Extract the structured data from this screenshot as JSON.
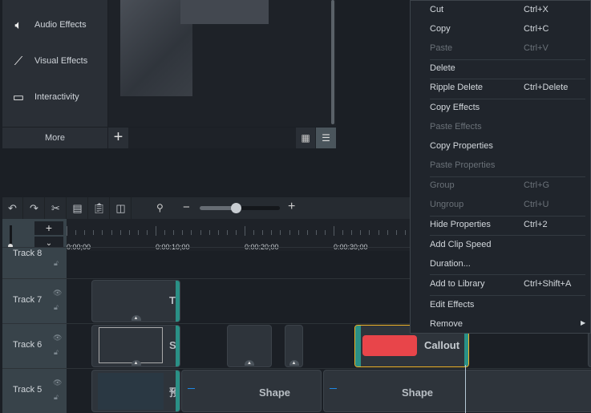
{
  "sidebar": {
    "items": [
      {
        "label": "Audio Effects",
        "icon": "speaker-icon"
      },
      {
        "label": "Visual Effects",
        "icon": "magic-wand-icon"
      },
      {
        "label": "Interactivity",
        "icon": "interactivity-icon"
      }
    ],
    "more_label": "More"
  },
  "media": {
    "add_label": "+",
    "view_grid_icon": "grid-icon",
    "view_list_icon": "list-icon"
  },
  "toolbar": {
    "zoom_minus": "−",
    "zoom_plus": "+",
    "zoom_level": 0.45
  },
  "ruler": {
    "labels": [
      "0:00;00",
      "0:00:10;00",
      "0:00:20;00",
      "0:00:30;00"
    ]
  },
  "tracks": [
    {
      "name": "Track 8"
    },
    {
      "name": "Track 7"
    },
    {
      "name": "Track 6"
    },
    {
      "name": "Track 5"
    }
  ],
  "clips": {
    "t7_label": "T",
    "t6_label": "S",
    "callout_label": "Callout",
    "t5_label": "预",
    "shape1": "Shape",
    "shape2": "Shape"
  },
  "colors": {
    "accent_teal": "#2a9086",
    "selection": "#f0b429",
    "callout_red": "#e8454a"
  },
  "context_menu": {
    "items": [
      {
        "label": "Cut",
        "shortcut": "Ctrl+X",
        "enabled": true
      },
      {
        "label": "Copy",
        "shortcut": "Ctrl+C",
        "enabled": true
      },
      {
        "label": "Paste",
        "shortcut": "Ctrl+V",
        "enabled": false
      },
      {
        "label": "Delete",
        "shortcut": "",
        "enabled": true
      },
      {
        "label": "Ripple Delete",
        "shortcut": "Ctrl+Delete",
        "enabled": true
      },
      {
        "label": "Copy Effects",
        "shortcut": "",
        "enabled": true
      },
      {
        "label": "Paste Effects",
        "shortcut": "",
        "enabled": false
      },
      {
        "label": "Copy Properties",
        "shortcut": "",
        "enabled": true
      },
      {
        "label": "Paste Properties",
        "shortcut": "",
        "enabled": false
      },
      {
        "label": "Group",
        "shortcut": "Ctrl+G",
        "enabled": false
      },
      {
        "label": "Ungroup",
        "shortcut": "Ctrl+U",
        "enabled": false
      },
      {
        "label": "Hide Properties",
        "shortcut": "Ctrl+2",
        "enabled": true
      },
      {
        "label": "Add Clip Speed",
        "shortcut": "",
        "enabled": true
      },
      {
        "label": "Duration...",
        "shortcut": "",
        "enabled": true
      },
      {
        "label": "Add to Library",
        "shortcut": "Ctrl+Shift+A",
        "enabled": true
      },
      {
        "label": "Edit Effects",
        "shortcut": "",
        "enabled": true
      },
      {
        "label": "Remove",
        "shortcut": "",
        "enabled": true,
        "submenu": true
      }
    ]
  }
}
